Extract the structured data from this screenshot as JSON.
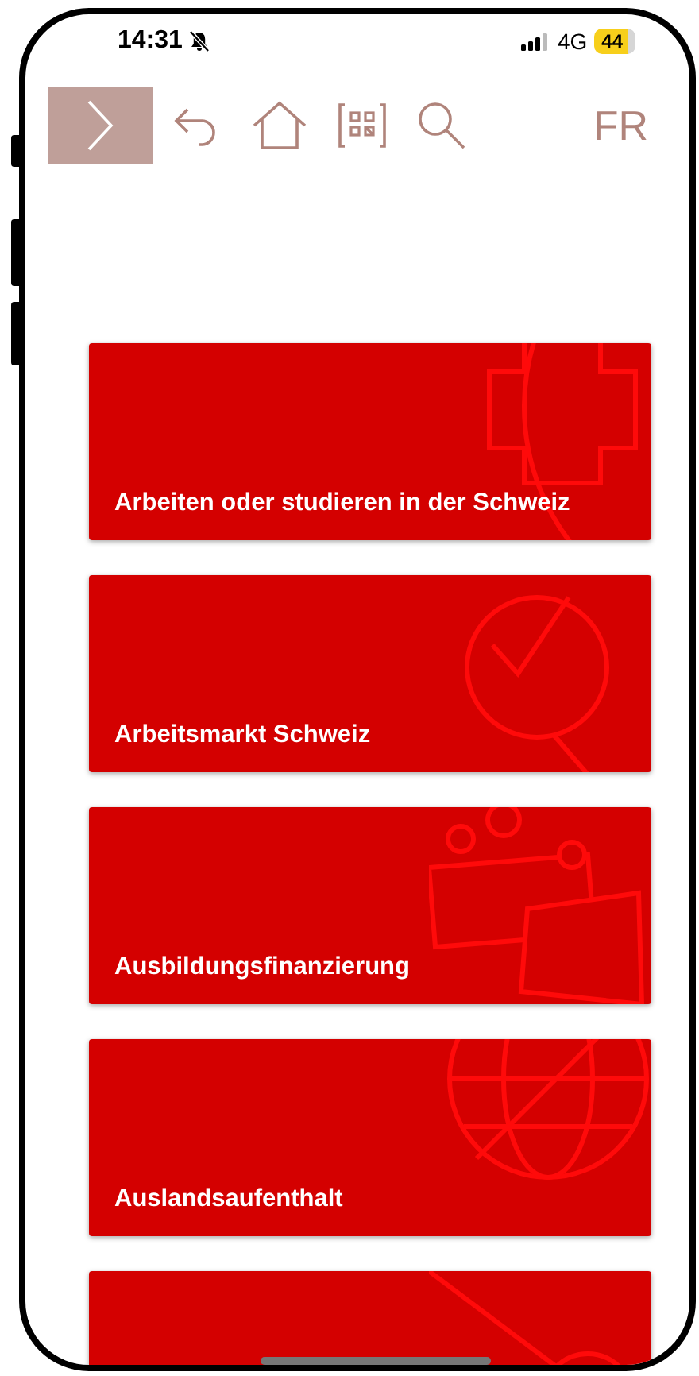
{
  "status_bar": {
    "time": "14:31",
    "silent": true,
    "network": "4G",
    "battery": "44"
  },
  "toolbar": {
    "language": "FR"
  },
  "tiles": [
    {
      "kind": "cross",
      "title": "Arbeiten oder studieren in der Schweiz"
    },
    {
      "kind": "magnifier",
      "title": "Arbeitsmarkt Schweiz"
    },
    {
      "kind": "money",
      "title": "Ausbildungsfinanzierung"
    },
    {
      "kind": "globe",
      "title": "Auslandsaufenthalt"
    },
    {
      "kind": "network"
    }
  ]
}
